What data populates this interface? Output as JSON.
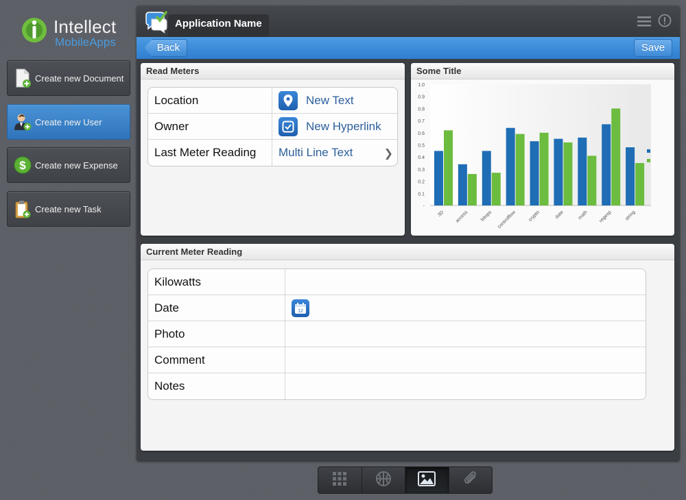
{
  "brand": {
    "name_line1": "Intellect",
    "name_line2": "MobileApps"
  },
  "sidebar": {
    "items": [
      {
        "label": "Create new Document",
        "icon": "document-add-icon",
        "active": false
      },
      {
        "label": "Create new User",
        "icon": "user-add-icon",
        "active": true
      },
      {
        "label": "Create new Expense",
        "icon": "dollar-icon",
        "active": false
      },
      {
        "label": "Create new Task",
        "icon": "clipboard-add-icon",
        "active": false
      }
    ]
  },
  "header": {
    "app_name": "Application Name",
    "back_label": "Back",
    "save_label": "Save"
  },
  "read_meters": {
    "title": "Read Meters",
    "rows": [
      {
        "label": "Location",
        "value": "New Text",
        "icon": "map-pin-icon"
      },
      {
        "label": "Owner",
        "value": "New Hyperlink",
        "icon": "checkbox-icon"
      },
      {
        "label": "Last Meter Reading",
        "value": "Multi Line Text",
        "icon": "chevron-right-icon"
      }
    ]
  },
  "chart_panel": {
    "title": "Some Title"
  },
  "chart_data": {
    "type": "bar",
    "categories": [
      "3D",
      "access",
      "bitops",
      "controlflow",
      "crypto",
      "date",
      "math",
      "regexp",
      "string"
    ],
    "series": [
      {
        "color": "#1f6db5",
        "values": [
          0.45,
          0.34,
          0.45,
          0.64,
          0.53,
          0.55,
          0.56,
          0.67,
          0.48
        ]
      },
      {
        "color": "#6cbc3f",
        "values": [
          0.62,
          0.26,
          0.27,
          0.59,
          0.6,
          0.52,
          0.41,
          0.8,
          0.35
        ]
      }
    ],
    "yticks": [
      "1.0",
      "0.9",
      "0.8",
      "0.7",
      "0.6",
      "0.5",
      "0.4",
      "0.3",
      "0.2",
      "0.1",
      "-"
    ],
    "ylim": [
      0,
      1.0
    ],
    "legend": "right",
    "grid": false
  },
  "current_reading": {
    "title": "Current Meter Reading",
    "rows": [
      {
        "label": "Kilowatts",
        "value": ""
      },
      {
        "label": "Date",
        "value": "",
        "icon": "calendar-icon",
        "icon_text": "12"
      },
      {
        "label": "Photo",
        "value": ""
      },
      {
        "label": "Comment",
        "value": ""
      },
      {
        "label": "Notes",
        "value": ""
      }
    ]
  },
  "toolbar": {
    "buttons": [
      {
        "icon": "grid-icon",
        "active": false
      },
      {
        "icon": "basketball-icon",
        "active": false
      },
      {
        "icon": "image-icon",
        "active": true
      },
      {
        "icon": "paperclip-icon",
        "active": false
      }
    ]
  },
  "colors": {
    "accent": "#3a8ad9",
    "panel": "#3b3e43",
    "series1": "#1f6db5",
    "series2": "#6cbc3f"
  }
}
